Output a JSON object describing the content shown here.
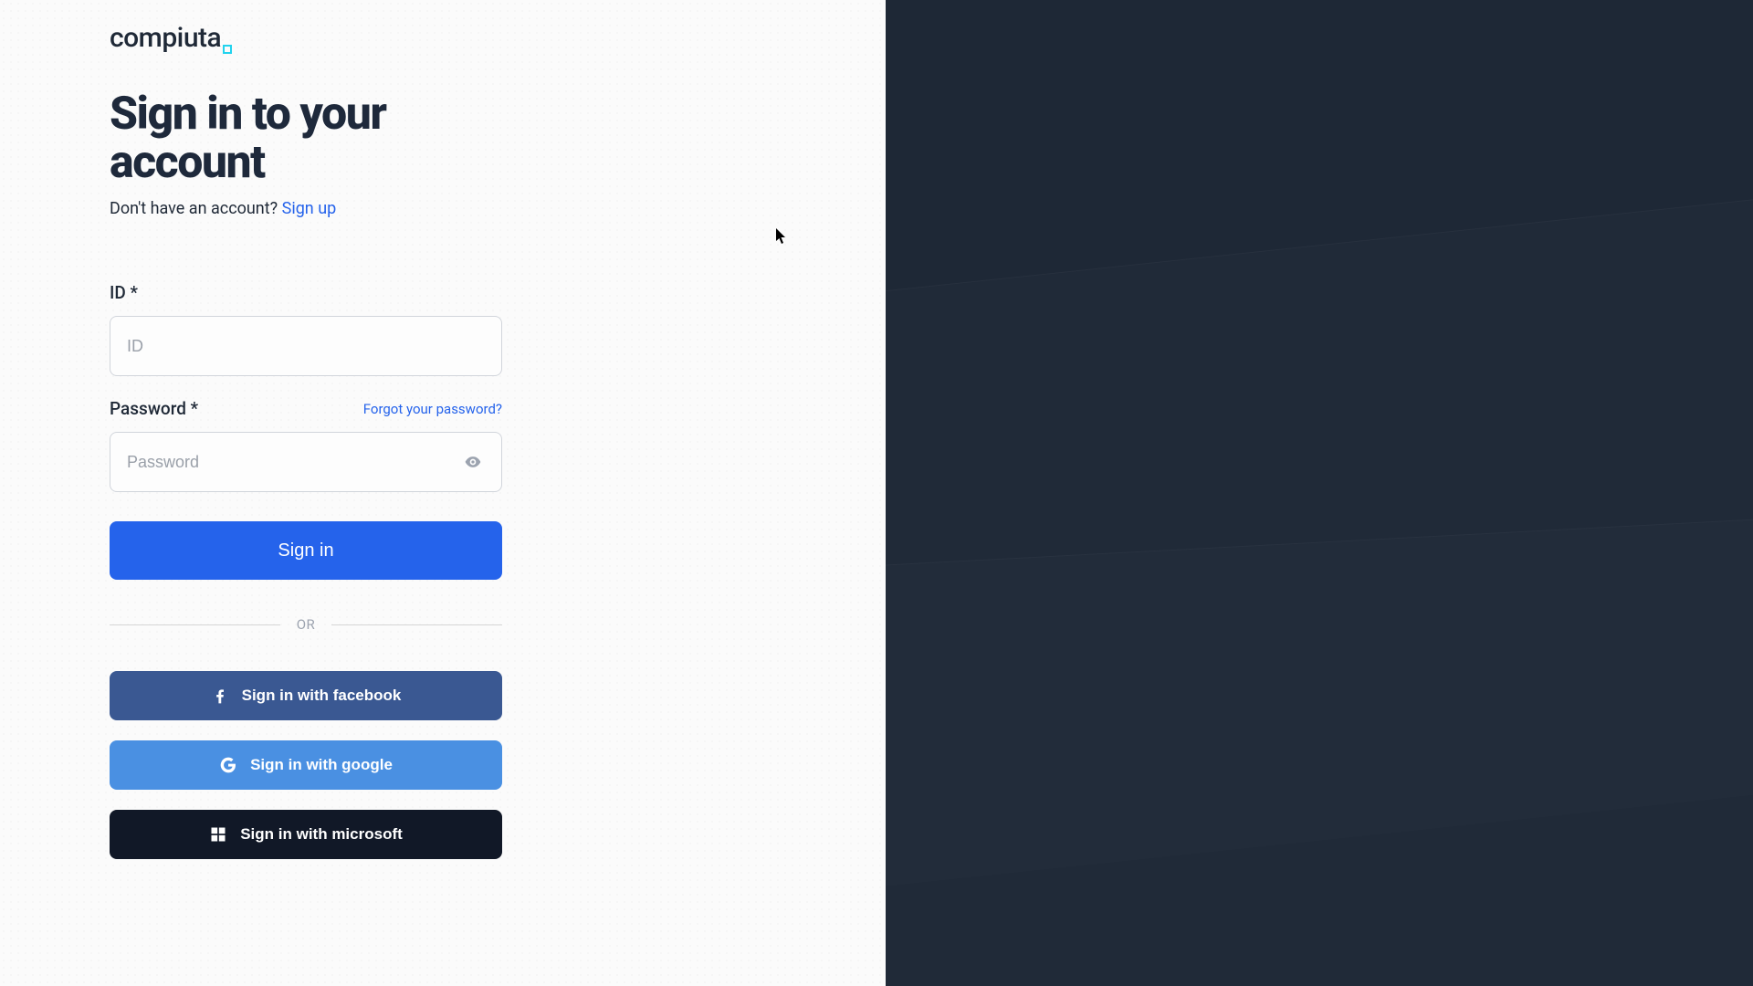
{
  "logo": {
    "text": "compiuta"
  },
  "heading": "Sign in to your account",
  "subtext": "Don't have an account? ",
  "signup_link": "Sign up",
  "fields": {
    "id": {
      "label": "ID *",
      "placeholder": "ID"
    },
    "password": {
      "label": "Password *",
      "placeholder": "Password"
    }
  },
  "forgot_link": "Forgot your password?",
  "signin_button": "Sign in",
  "divider": "OR",
  "social": {
    "facebook": "Sign in with facebook",
    "google": "Sign in with google",
    "microsoft": "Sign in with microsoft"
  }
}
